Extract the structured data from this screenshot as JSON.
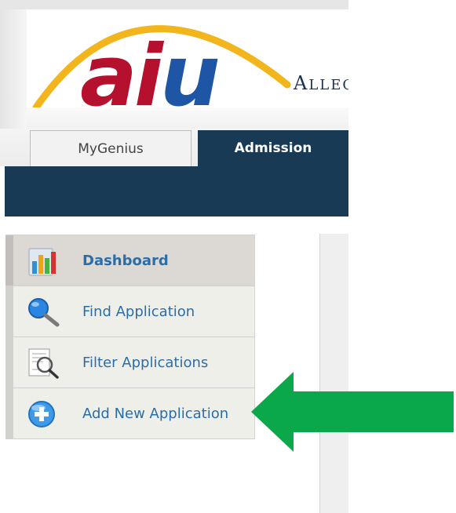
{
  "header": {
    "logo_text": "aiu",
    "tagline_partial": "Alleg",
    "brand_colors": {
      "logo_red": "#b5112f",
      "logo_blue": "#1e56a5",
      "arc_yellow": "#f2b51c",
      "navy": "#183a54"
    }
  },
  "tabs": [
    {
      "label": "MyGenius",
      "active": false
    },
    {
      "label": "Admission",
      "active": true
    }
  ],
  "sidebar": {
    "items": [
      {
        "label": "Dashboard",
        "icon": "bar-chart-icon",
        "active": true
      },
      {
        "label": "Find Application",
        "icon": "magnifier-icon",
        "active": false
      },
      {
        "label": "Filter Applications",
        "icon": "filter-document-icon",
        "active": false
      },
      {
        "label": "Add New Application",
        "icon": "add-circle-icon",
        "active": false
      }
    ]
  },
  "annotation": {
    "arrow_color": "#0aa84a",
    "points_to": "Add New Application"
  }
}
